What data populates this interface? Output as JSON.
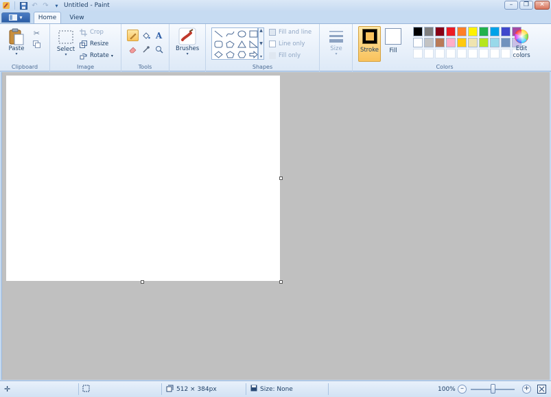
{
  "window": {
    "title": "Untitled - Paint"
  },
  "tabs": [
    {
      "label": "Home"
    },
    {
      "label": "View"
    }
  ],
  "groups": {
    "clipboard": {
      "label": "Clipboard",
      "paste": "Paste"
    },
    "image": {
      "label": "Image",
      "select": "Select",
      "crop": "Crop",
      "resize": "Resize",
      "rotate": "Rotate"
    },
    "tools": {
      "label": "Tools"
    },
    "brushes": {
      "label": "Brushes"
    },
    "shapes": {
      "label": "Shapes",
      "fill_and_line": "Fill and line",
      "line_only": "Line only",
      "fill_only": "Fill only"
    },
    "size": {
      "label": "Size"
    },
    "colors": {
      "label": "Colors",
      "stroke": "Stroke",
      "fill": "Fill",
      "edit_line1": "Edit",
      "edit_line2": "colors",
      "stroke_color": "#000000",
      "fill_color": "#ffffff",
      "palette": [
        "#000000",
        "#7f7f7f",
        "#880015",
        "#ed1c24",
        "#ff7f27",
        "#fff200",
        "#22b14c",
        "#00a2e8",
        "#3f48cc",
        "#a349a4",
        "#ffffff",
        "#c3c3c3",
        "#b97a57",
        "#ffaec9",
        "#ffc90e",
        "#efe4b0",
        "#b5e61d",
        "#99d9ea",
        "#7092be",
        "#c8bfe7",
        "#ffffff",
        "#ffffff",
        "#ffffff",
        "#ffffff",
        "#ffffff",
        "#ffffff",
        "#ffffff",
        "#ffffff",
        "#ffffff",
        "#ffffff"
      ]
    }
  },
  "status": {
    "dimensions": "512 × 384px",
    "size": "Size: None",
    "zoom": "100%"
  }
}
